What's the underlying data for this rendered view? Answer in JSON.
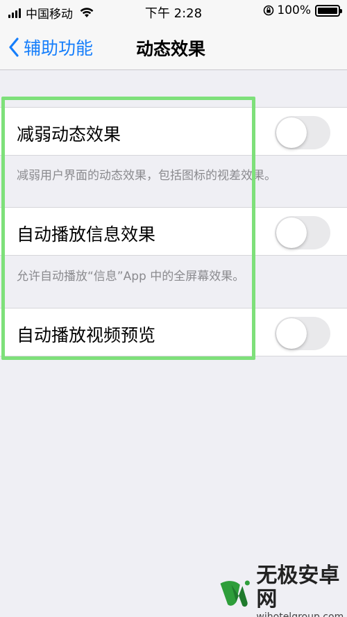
{
  "status_bar": {
    "carrier": "中国移动",
    "time": "下午 2:28",
    "battery_percent": "100%",
    "icons": [
      "signal-icon",
      "wifi-icon",
      "rotation-lock-icon",
      "battery-icon"
    ]
  },
  "nav": {
    "back_label": "辅助功能",
    "title": "动态效果",
    "accent_color": "#157efb"
  },
  "settings": [
    {
      "label": "减弱动态效果",
      "enabled": false,
      "footer": "减弱用户界面的动态效果，包括图标的视差效果。"
    },
    {
      "label": "自动播放信息效果",
      "enabled": false,
      "footer": "允许自动播放“信息”App 中的全屏幕效果。"
    },
    {
      "label": "自动播放视频预览",
      "enabled": false
    }
  ],
  "highlight_color": "#7ee07a",
  "watermark": {
    "title": "无极安卓网",
    "url": "wjhotelgroup.com"
  }
}
